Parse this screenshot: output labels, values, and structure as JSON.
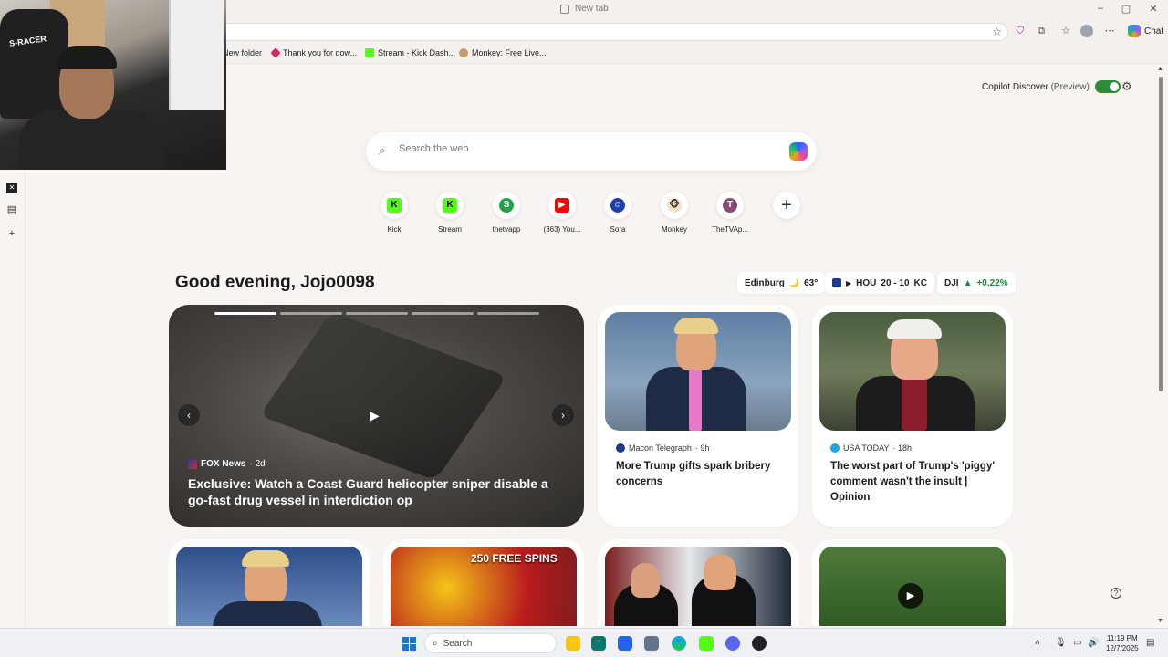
{
  "window": {
    "tab_title": "New tab",
    "minimize": "–",
    "restore": "▢",
    "close": "✕"
  },
  "toolbar": {
    "chat_label": "Chat"
  },
  "bookmarks": [
    {
      "label": "New folder",
      "color": "#e8b400"
    },
    {
      "label": "Thank you for dow...",
      "color": "#e0245e"
    },
    {
      "label": "Stream - Kick Dash...",
      "color": "#53fc18"
    },
    {
      "label": "Monkey: Free Live...",
      "color": "#c69c6d"
    }
  ],
  "webcam": {
    "chair_text": "S-RACER"
  },
  "copilot_discover": {
    "label": "Copilot Discover",
    "preview": "(Preview)",
    "enabled": true
  },
  "search": {
    "placeholder": "Search the web"
  },
  "quick_links": [
    {
      "label": "Kick",
      "glyph": "K",
      "bg": "#53fc18",
      "fg": "#000"
    },
    {
      "label": "Stream",
      "glyph": "K",
      "bg": "#53fc18",
      "fg": "#000"
    },
    {
      "label": "thetvapp",
      "glyph": "S",
      "bg": "#22a34a",
      "fg": "#fff"
    },
    {
      "label": "(363) You...",
      "glyph": "▶",
      "bg": "#ff0000",
      "fg": "#fff"
    },
    {
      "label": "Sora",
      "glyph": "☺",
      "bg": "#1e40af",
      "fg": "#fff"
    },
    {
      "label": "Monkey",
      "glyph": "🐵",
      "bg": "#f3e2c7",
      "fg": "#000"
    },
    {
      "label": "TheTVAp...",
      "glyph": "T",
      "bg": "#8b4a7a",
      "fg": "#fff"
    }
  ],
  "greeting": "Good evening, Jojo0098",
  "widgets": {
    "weather": {
      "city": "Edinburg",
      "icon": "🌙",
      "temp": "63°"
    },
    "score": {
      "team1": "HOU",
      "score": "20 - 10",
      "team2": "KC",
      "play": "▶"
    },
    "stock": {
      "ticker": "DJI",
      "arrow": "▲",
      "change": "+0.22%"
    }
  },
  "hero": {
    "source": "FOX News",
    "age": "· 2d",
    "title": "Exclusive: Watch a Coast Guard helicopter sniper disable a go-fast drug vessel in interdiction op",
    "prev": "‹",
    "next": "›",
    "play": "▶"
  },
  "cards": [
    {
      "source": "Macon Telegraph",
      "age": "· 9h",
      "title": "More Trump gifts spark bribery concerns",
      "src_color": "#1e3a8a"
    },
    {
      "source": "USA TODAY",
      "age": "· 18h",
      "title": "The worst part of Trump's 'piggy' comment wasn't the insult | Opinion",
      "src_color": "#1ea5e9"
    }
  ],
  "bottom_cards": {
    "spins_text": "250 FREE SPINS",
    "video_play": "▶"
  },
  "taskbar": {
    "search_label": "Search",
    "time": "11:19 PM",
    "date": "12/7/2025"
  }
}
